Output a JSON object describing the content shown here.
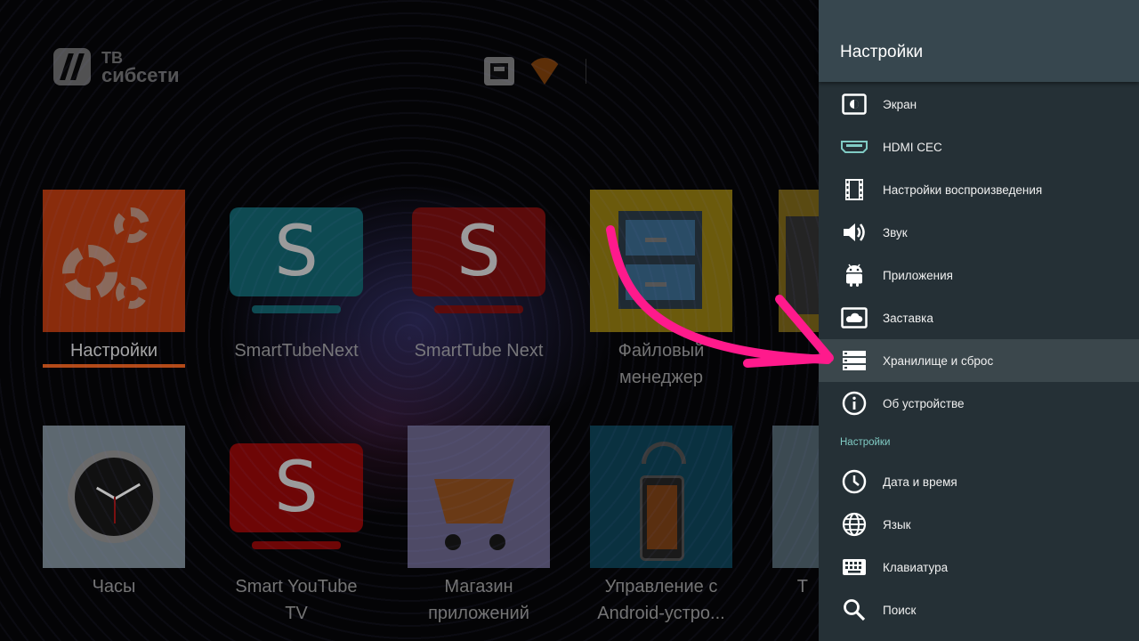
{
  "launcher": {
    "logo": {
      "line1": "ТВ",
      "line2": "сибсети"
    },
    "tiles": [
      {
        "id": "settings",
        "label": "Настройки"
      },
      {
        "id": "smarttube-next-1",
        "label": "SmartTubeNext"
      },
      {
        "id": "smarttube-next-2",
        "label": "SmartTube Next"
      },
      {
        "id": "file-manager",
        "label": "Файловый менеджер"
      },
      {
        "id": "clock",
        "label": "Часы"
      },
      {
        "id": "smart-youtube-tv",
        "label": "Smart YouTube TV"
      },
      {
        "id": "app-store",
        "label": "Магазин приложений"
      },
      {
        "id": "android-remote",
        "label": "Управление с Android-устро..."
      }
    ],
    "partial_tile_label": "Т"
  },
  "settings_panel": {
    "title": "Настройки",
    "items": [
      {
        "label": "Экран",
        "icon": "display-icon"
      },
      {
        "label": "HDMI CEC",
        "icon": "hdmi-icon"
      },
      {
        "label": "Настройки воспроизведения",
        "icon": "film-icon"
      },
      {
        "label": "Звук",
        "icon": "speaker-icon"
      },
      {
        "label": "Приложения",
        "icon": "android-icon"
      },
      {
        "label": "Заставка",
        "icon": "screensaver-icon"
      },
      {
        "label": "Хранилище и сброс",
        "icon": "storage-icon",
        "selected": true
      },
      {
        "label": "Об устройстве",
        "icon": "info-icon"
      }
    ],
    "section_header": "Настройки",
    "items2": [
      {
        "label": "Дата и время",
        "icon": "clock-icon"
      },
      {
        "label": "Язык",
        "icon": "globe-icon"
      },
      {
        "label": "Клавиатура",
        "icon": "keyboard-icon"
      },
      {
        "label": "Поиск",
        "icon": "search-icon"
      }
    ]
  },
  "colors": {
    "panel_bg": "#253036",
    "panel_header_bg": "#37474f",
    "selected_item_bg": "#3b474c",
    "section_header": "#80cbc4",
    "hdmi_icon": "#80cbc4",
    "annotation_arrow": "#ff1a8c",
    "focus_underline": "#b44a18"
  }
}
